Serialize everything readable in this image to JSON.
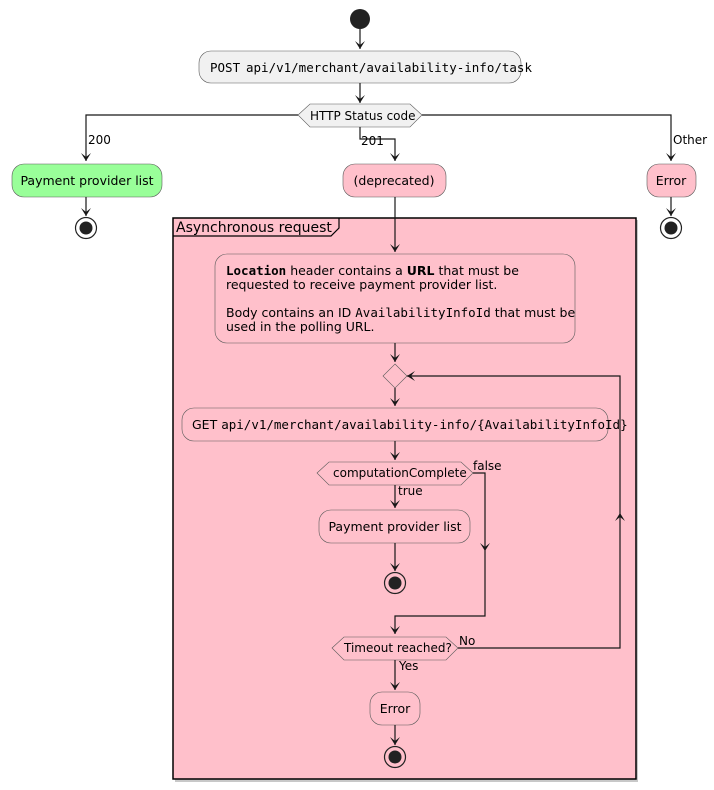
{
  "diagram": {
    "type": "activity",
    "colors": {
      "default_fill": "#F1F1F1",
      "success_fill": "#99FF99",
      "deprecated_fill": "#FFC0CB",
      "frame_fill": "#FFC0CB",
      "line": "#181818"
    },
    "post_action": {
      "method": "POST",
      "path": "api/v1/merchant/availability-info/task"
    },
    "status_decision": {
      "label": "HTTP Status code"
    },
    "branches": {
      "ok": {
        "guard": "200",
        "action": "Payment provider list"
      },
      "created": {
        "guard": "201",
        "action": "(deprecated)"
      },
      "other": {
        "guard": "Other",
        "action": "Error"
      }
    },
    "frame": {
      "title": "Asynchronous request",
      "note": {
        "line1_bold_mono": "Location",
        "line1_text_a": " header contains a ",
        "line1_bold": "URL",
        "line1_text_b": " that must be",
        "line2": "requested to receive payment provider list.",
        "line3_text_a": "Body contains an ID ",
        "line3_mono": "AvailabilityInfoId",
        "line3_text_b": " that must be",
        "line4": "used in the polling URL."
      },
      "get_action": {
        "method": "GET",
        "path": "api/v1/merchant/availability-info/{AvailabilityInfoId}"
      },
      "computation_decision": {
        "label": "computationComplete",
        "true_guard": "true",
        "false_guard": "false"
      },
      "success_action": "Payment provider list",
      "timeout_decision": {
        "label": "Timeout reached?",
        "yes_guard": "Yes",
        "no_guard": "No"
      },
      "error_action": "Error"
    }
  }
}
